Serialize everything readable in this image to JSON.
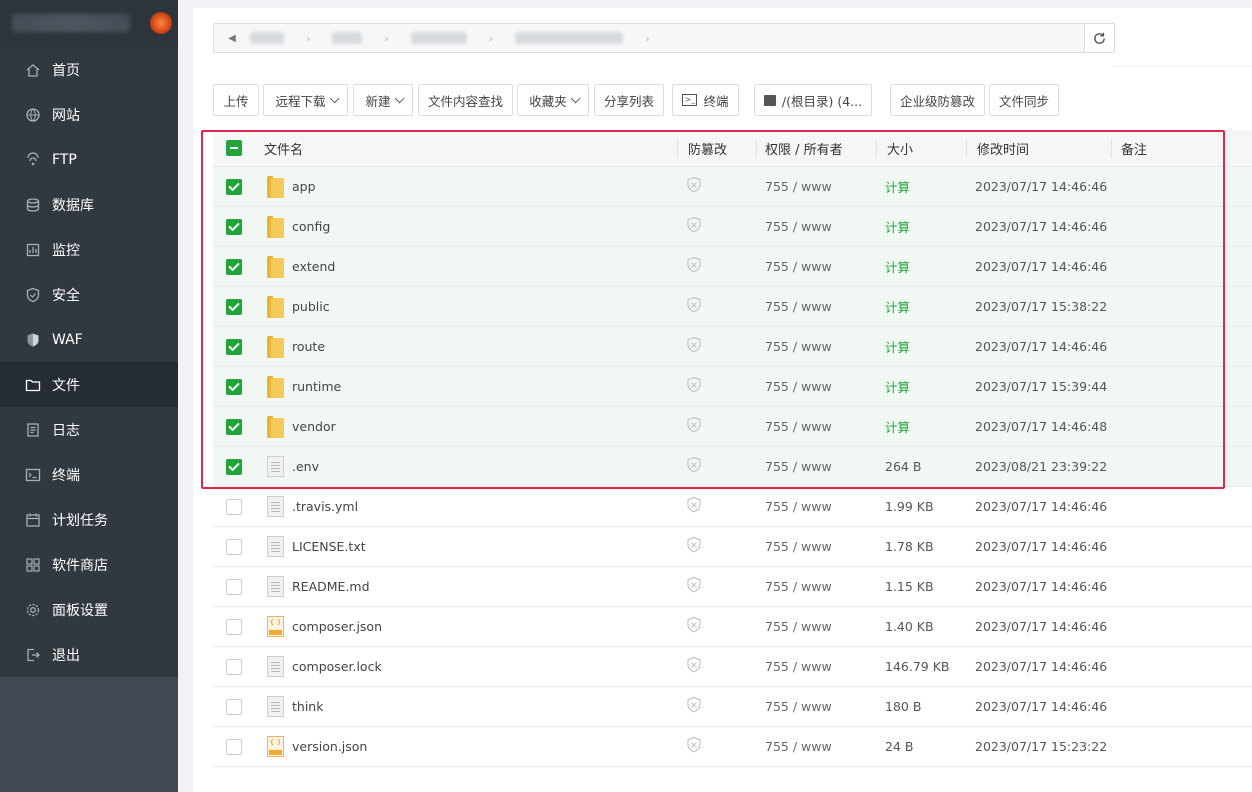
{
  "sidebar": {
    "items": [
      {
        "label": "首页",
        "icon": "home-icon"
      },
      {
        "label": "网站",
        "icon": "globe-icon"
      },
      {
        "label": "FTP",
        "icon": "ftp-icon"
      },
      {
        "label": "数据库",
        "icon": "database-icon"
      },
      {
        "label": "监控",
        "icon": "monitor-icon"
      },
      {
        "label": "安全",
        "icon": "shield-icon"
      },
      {
        "label": "WAF",
        "icon": "waf-shield-icon"
      },
      {
        "label": "文件",
        "icon": "folder-icon"
      },
      {
        "label": "日志",
        "icon": "log-icon"
      },
      {
        "label": "终端",
        "icon": "terminal-icon"
      },
      {
        "label": "计划任务",
        "icon": "calendar-icon"
      },
      {
        "label": "软件商店",
        "icon": "apps-icon"
      },
      {
        "label": "面板设置",
        "icon": "settings-icon"
      },
      {
        "label": "退出",
        "icon": "logout-icon"
      }
    ],
    "active": "文件"
  },
  "toolbar": {
    "upload": "上传",
    "remote_download": "远程下载",
    "new": "新建",
    "content_search": "文件内容查找",
    "favorites": "收藏夹",
    "share_list": "分享列表",
    "terminal": "终端",
    "disk": "/(根目录) (4...",
    "enterprise_tamper": "企业级防篡改",
    "file_sync": "文件同步"
  },
  "table": {
    "headers": {
      "name": "文件名",
      "protect": "防篡改",
      "perm": "权限 / 所有者",
      "size": "大小",
      "mtime": "修改时间",
      "note": "备注"
    },
    "rows": [
      {
        "name": "app",
        "type": "folder",
        "checked": true,
        "perm": "755 / www",
        "size": "计算",
        "mtime": "2023/07/17 14:46:46"
      },
      {
        "name": "config",
        "type": "folder",
        "checked": true,
        "perm": "755 / www",
        "size": "计算",
        "mtime": "2023/07/17 14:46:46"
      },
      {
        "name": "extend",
        "type": "folder",
        "checked": true,
        "perm": "755 / www",
        "size": "计算",
        "mtime": "2023/07/17 14:46:46"
      },
      {
        "name": "public",
        "type": "folder",
        "checked": true,
        "perm": "755 / www",
        "size": "计算",
        "mtime": "2023/07/17 15:38:22"
      },
      {
        "name": "route",
        "type": "folder",
        "checked": true,
        "perm": "755 / www",
        "size": "计算",
        "mtime": "2023/07/17 14:46:46"
      },
      {
        "name": "runtime",
        "type": "folder",
        "checked": true,
        "perm": "755 / www",
        "size": "计算",
        "mtime": "2023/07/17 15:39:44"
      },
      {
        "name": "vendor",
        "type": "folder",
        "checked": true,
        "perm": "755 / www",
        "size": "计算",
        "mtime": "2023/07/17 14:46:48"
      },
      {
        "name": ".env",
        "type": "file",
        "checked": true,
        "perm": "755 / www",
        "size": "264 B",
        "mtime": "2023/08/21 23:39:22"
      },
      {
        "name": ".travis.yml",
        "type": "file",
        "checked": false,
        "perm": "755 / www",
        "size": "1.99 KB",
        "mtime": "2023/07/17 14:46:46"
      },
      {
        "name": "LICENSE.txt",
        "type": "file",
        "checked": false,
        "perm": "755 / www",
        "size": "1.78 KB",
        "mtime": "2023/07/17 14:46:46"
      },
      {
        "name": "README.md",
        "type": "file",
        "checked": false,
        "perm": "755 / www",
        "size": "1.15 KB",
        "mtime": "2023/07/17 14:46:46"
      },
      {
        "name": "composer.json",
        "type": "json",
        "checked": false,
        "perm": "755 / www",
        "size": "1.40 KB",
        "mtime": "2023/07/17 14:46:46"
      },
      {
        "name": "composer.lock",
        "type": "file",
        "checked": false,
        "perm": "755 / www",
        "size": "146.79 KB",
        "mtime": "2023/07/17 14:46:46"
      },
      {
        "name": "think",
        "type": "file",
        "checked": false,
        "perm": "755 / www",
        "size": "180 B",
        "mtime": "2023/07/17 14:46:46"
      },
      {
        "name": "version.json",
        "type": "json",
        "checked": false,
        "perm": "755 / www",
        "size": "24 B",
        "mtime": "2023/07/17 15:23:22"
      }
    ]
  },
  "colors": {
    "accent": "#20a53a",
    "highlight_box": "#e0264a",
    "sidebar_bg": "#313840"
  }
}
